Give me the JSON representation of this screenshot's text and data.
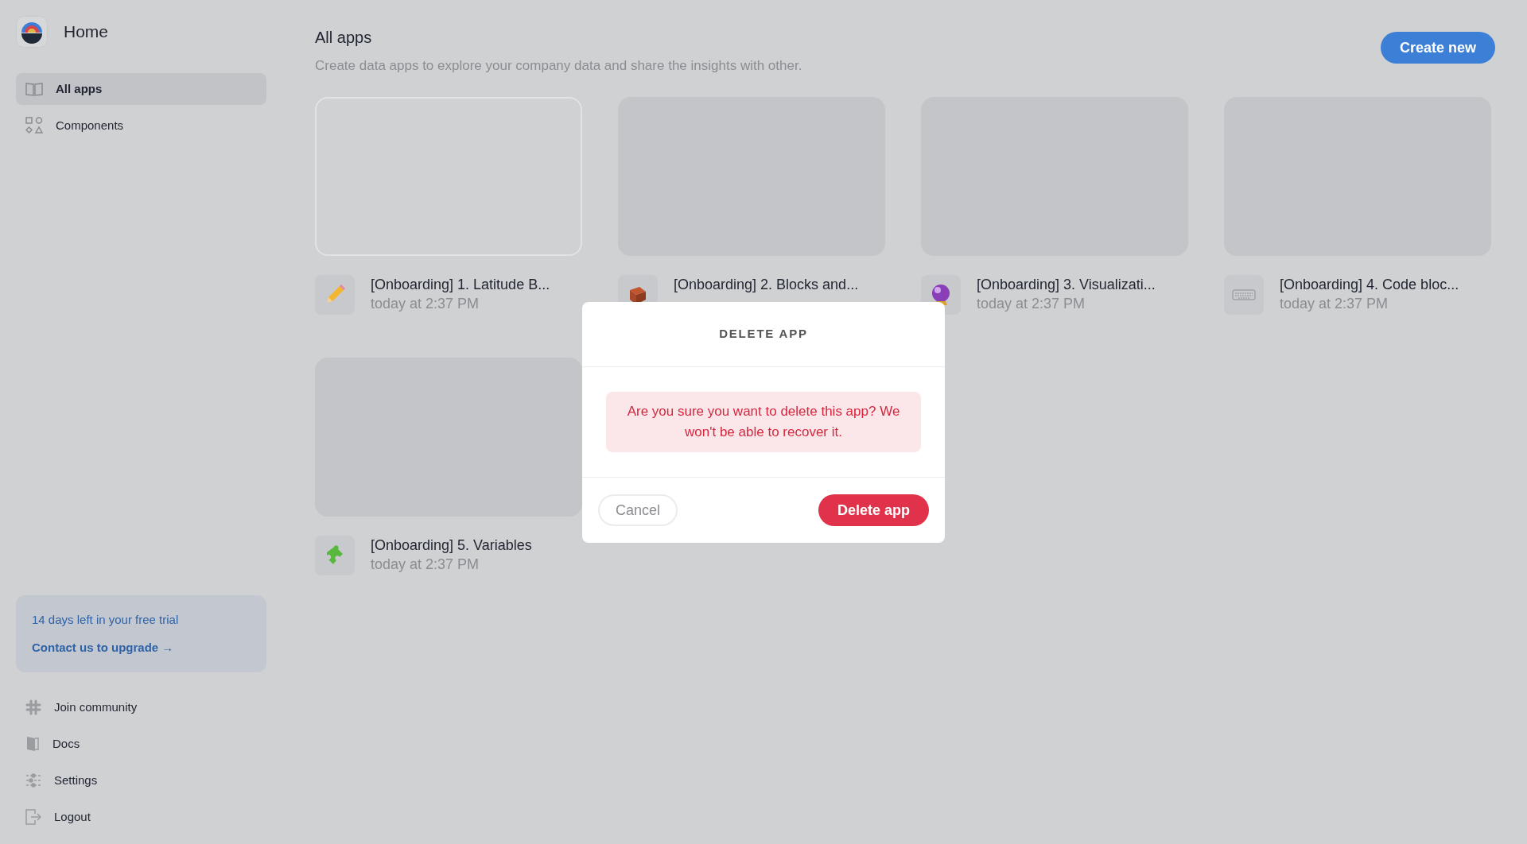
{
  "sidebar": {
    "title": "Home",
    "nav": [
      {
        "label": "All apps",
        "selected": true
      },
      {
        "label": "Components",
        "selected": false
      }
    ],
    "trial": {
      "text": "14 days left in your free trial",
      "link": "Contact us to upgrade →"
    },
    "footer": [
      {
        "label": "Join community"
      },
      {
        "label": "Docs"
      },
      {
        "label": "Settings"
      },
      {
        "label": "Logout"
      }
    ]
  },
  "main": {
    "title": "All apps",
    "subtitle": "Create data apps to explore your company data and share the insights with other.",
    "create_button": "Create new",
    "apps": [
      {
        "name": "[Onboarding] 1. Latitude B...",
        "time": "today at 2:37 PM",
        "selected": true
      },
      {
        "name": "[Onboarding] 2. Blocks and...",
        "selected": false
      },
      {
        "name": "[Onboarding] 3. Visualizati...",
        "time": "today at 2:37 PM",
        "selected": false
      },
      {
        "name": "[Onboarding] 4. Code bloc...",
        "time": "today at 2:37 PM",
        "selected": false
      },
      {
        "name": "[Onboarding] 5. Variables",
        "time": "today at 2:37 PM",
        "selected": false
      }
    ]
  },
  "dialog": {
    "title": "DELETE APP",
    "message": "Are you sure you want to delete this app? We won't be able to recover it.",
    "cancel": "Cancel",
    "confirm": "Delete app"
  }
}
